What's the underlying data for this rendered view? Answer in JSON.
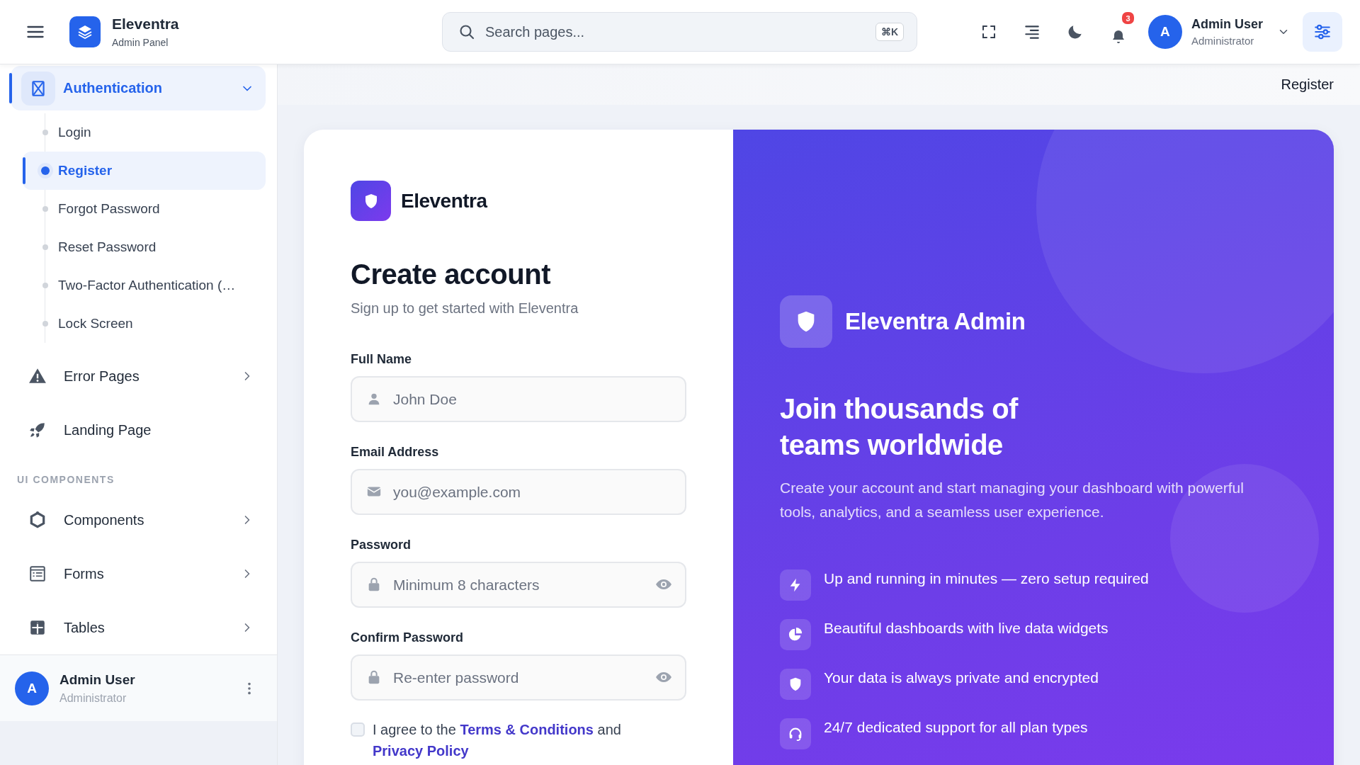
{
  "topbar": {
    "brand": "Eleventra",
    "subtitle": "Admin Panel",
    "search": {
      "placeholder": "Search pages...",
      "shortcut": "⌘K"
    },
    "notifications": "3",
    "user": {
      "initial": "A",
      "name": "Admin User",
      "role": "Administrator"
    }
  },
  "sidebar": {
    "sections": [
      {
        "items": [
          {
            "label": "Authentication",
            "kind": "group",
            "expanded": true,
            "selected": true,
            "children": [
              {
                "label": "Login",
                "selected": false
              },
              {
                "label": "Register",
                "selected": true
              },
              {
                "label": "Forgot Password",
                "selected": false
              },
              {
                "label": "Reset Password",
                "selected": false
              },
              {
                "label": "Two-Factor Authentication (…",
                "selected": false
              },
              {
                "label": "Lock Screen",
                "selected": false
              }
            ]
          },
          {
            "label": "Error Pages",
            "kind": "group",
            "expanded": false,
            "selected": false
          },
          {
            "label": "Landing Page",
            "kind": "link",
            "selected": false
          }
        ]
      },
      {
        "title": "UI COMPONENTS",
        "items": [
          {
            "label": "Components",
            "kind": "group",
            "expanded": false,
            "selected": false
          },
          {
            "label": "Forms",
            "kind": "group",
            "expanded": false,
            "selected": false
          },
          {
            "label": "Tables",
            "kind": "group",
            "expanded": false,
            "selected": false
          }
        ]
      }
    ],
    "user": {
      "initial": "A",
      "name": "Admin User",
      "role": "Administrator"
    }
  },
  "breadcrumb": "Register",
  "register": {
    "brand": "Eleventra",
    "title": "Create account",
    "subtitle": "Sign up to get started with Eleventra",
    "fields": [
      {
        "label": "Full Name",
        "kind": "text",
        "placeholder": "John Doe"
      },
      {
        "label": "Email Address",
        "kind": "email",
        "placeholder": "you@example.com"
      },
      {
        "label": "Password",
        "kind": "password",
        "placeholder": "Minimum 8 characters"
      },
      {
        "label": "Confirm Password",
        "kind": "password",
        "placeholder": "Re-enter password"
      }
    ],
    "agreement": {
      "checked": false,
      "parts": [
        {
          "kind": "text",
          "text": "I agree to the "
        },
        {
          "kind": "link",
          "text": "Terms & Conditions"
        },
        {
          "kind": "text",
          "text": " and "
        },
        {
          "kind": "link",
          "text": "Privacy Policy"
        }
      ]
    }
  },
  "promo": {
    "brand": "Eleventra Admin",
    "heading": "Join thousands of teams worldwide",
    "text": "Create your account and start managing your dashboard with powerful tools, analytics, and a seamless user experience.",
    "features": [
      "Up and running in minutes — zero setup required",
      "Beautiful dashboards with live data widgets",
      "Your data is always private and encrypted",
      "24/7 dedicated support for all plan types"
    ]
  }
}
